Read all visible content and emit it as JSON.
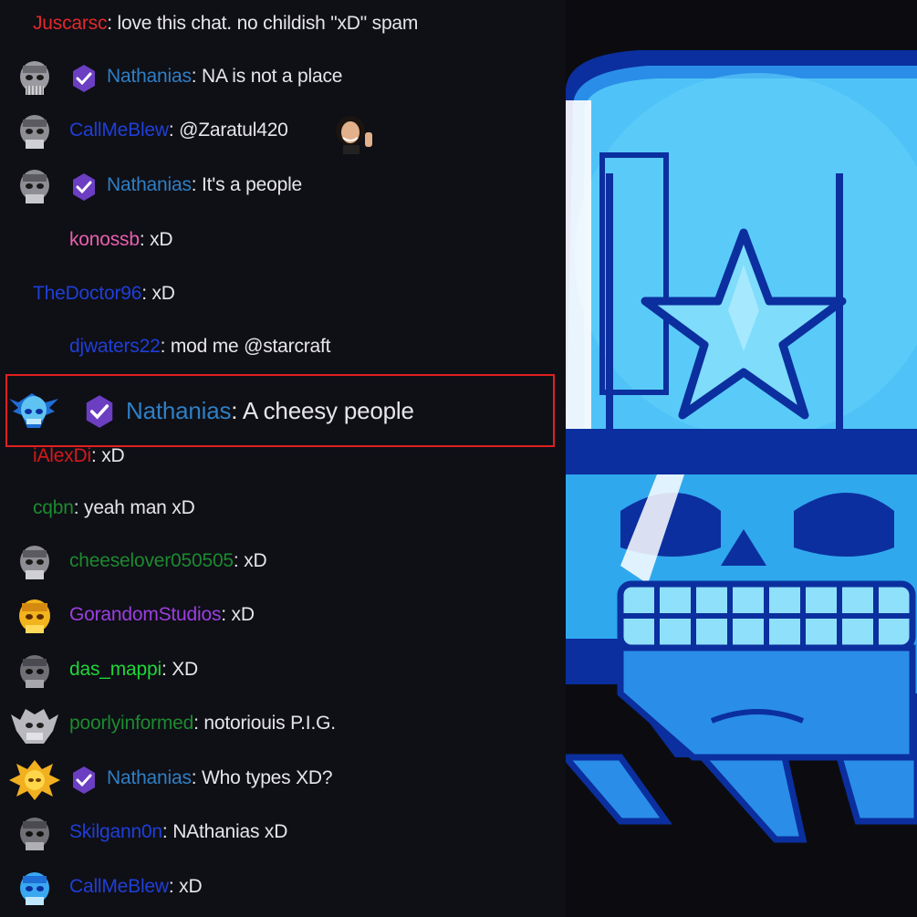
{
  "chat": {
    "messages": [
      {
        "user": "Juscarsc",
        "sep": ":",
        "text": " love this chat. no childish \"xD\" spam",
        "color": "#e02a2a"
      },
      {
        "user": "Nathanias",
        "sep": ":",
        "text": " NA is not a place",
        "color": "#2f7fc4",
        "avatar": "skull-avatar",
        "badge": "verified-badge"
      },
      {
        "user": "CallMeBlew",
        "sep": ":",
        "text": " @Zaratul420",
        "color": "#1f3fd8",
        "avatar": "skull-avatar",
        "emote": "waving-woman-emote"
      },
      {
        "user": "Nathanias",
        "sep": ":",
        "text": " It's a people",
        "color": "#2f7fc4",
        "avatar": "skull-avatar",
        "badge": "verified-badge"
      },
      {
        "user": "konossb",
        "sep": ":",
        "text": " xD",
        "color": "#e85fae"
      },
      {
        "user": "TheDoctor96",
        "sep": ":",
        "text": " xD",
        "color": "#1f3fd8"
      },
      {
        "user": "djwaters22",
        "sep": ":",
        "text": " mod me @starcraft",
        "color": "#1f3fd8"
      },
      {
        "user": "Nathanias",
        "sep": ":",
        "text": " A cheesy people",
        "color": "#2f7fc4",
        "avatar": "blue-skull-avatar",
        "badge": "verified-badge",
        "highlighted": true
      },
      {
        "user": "iAlexDi",
        "sep": ":",
        "text": " xD",
        "color": "#d41a1a"
      },
      {
        "user": "cqbn",
        "sep": ":",
        "text": " yeah man xD",
        "color": "#1c8a2e"
      },
      {
        "user": "cheeselover050505",
        "sep": ":",
        "text": " xD",
        "color": "#1c8a2e",
        "avatar": "skull-avatar"
      },
      {
        "user": "GorandomStudios",
        "sep": ":",
        "text": " xD",
        "color": "#9b3fe0",
        "avatar": "gold-skull-avatar"
      },
      {
        "user": "das_mappi",
        "sep": ":",
        "text": " XD",
        "color": "#1fd638",
        "avatar": "skull-avatar"
      },
      {
        "user": "poorlyinformed",
        "sep": ":",
        "text": " notoriouis P.I.G.",
        "color": "#1c8a2e",
        "avatar": "silver-skull-avatar"
      },
      {
        "user": "Nathanias",
        "sep": ":",
        "text": " Who types XD?",
        "color": "#2f7fc4",
        "avatar": "gold-crest-avatar",
        "badge": "verified-badge"
      },
      {
        "user": "Skilgann0n",
        "sep": ":",
        "text": " NAthanias xD",
        "color": "#1f3fd8",
        "avatar": "skull-avatar"
      },
      {
        "user": "CallMeBlew",
        "sep": ":",
        "text": " xD",
        "color": "#1f3fd8",
        "avatar": "blue-skull-avatar"
      }
    ]
  },
  "artwork": {
    "icon": "blue-skull-star-helmet-icon",
    "accent": "#2fb3f0",
    "dark": "#0b2f9e"
  }
}
